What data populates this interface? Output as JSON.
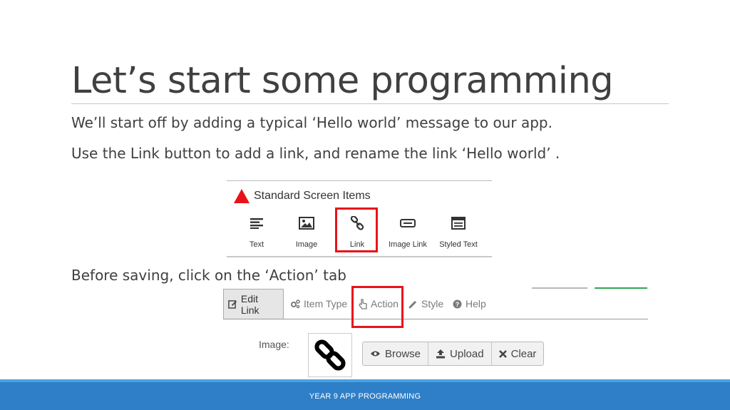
{
  "slide": {
    "title": "Let’s start some programming",
    "paragraphs": [
      "We’ll start off by adding a typical ‘Hello world’ message to our app.",
      "Use the Link button to add a link, and rename the link ‘Hello world’ .",
      "Before saving, click on the ‘Action’ tab"
    ],
    "footer": "YEAR 9 APP PROGRAMMING"
  },
  "screen_items": {
    "title": "Standard Screen Items",
    "title_icon": "warning-triangle-icon",
    "tools": [
      {
        "label": "Text",
        "icon": "text-lines-icon"
      },
      {
        "label": "Image",
        "icon": "picture-icon"
      },
      {
        "label": "Link",
        "icon": "chain-link-icon"
      },
      {
        "label": "Image Link",
        "icon": "image-link-icon"
      },
      {
        "label": "Styled Text",
        "icon": "styled-text-icon"
      }
    ],
    "highlighted": "Link"
  },
  "editor": {
    "tabs": [
      {
        "label": "Edit Link",
        "icon": "edit-icon"
      },
      {
        "label": "Item Type",
        "icon": "cogs-icon"
      },
      {
        "label": "Action",
        "icon": "hand-pointer-icon"
      },
      {
        "label": "Style",
        "icon": "brush-icon"
      },
      {
        "label": "Help",
        "icon": "help-circle-icon"
      }
    ],
    "active_tab": "Edit Link",
    "highlighted_tab": "Action",
    "image_label": "Image:",
    "buttons": [
      {
        "label": "Browse",
        "icon": "eye-icon"
      },
      {
        "label": "Upload",
        "icon": "upload-icon"
      },
      {
        "label": "Clear",
        "icon": "close-icon"
      }
    ]
  },
  "colors": {
    "highlight": "#e8131a",
    "footer_bg": "#2e7fc7",
    "title_text": "#404040",
    "green_accent": "#32a852"
  }
}
